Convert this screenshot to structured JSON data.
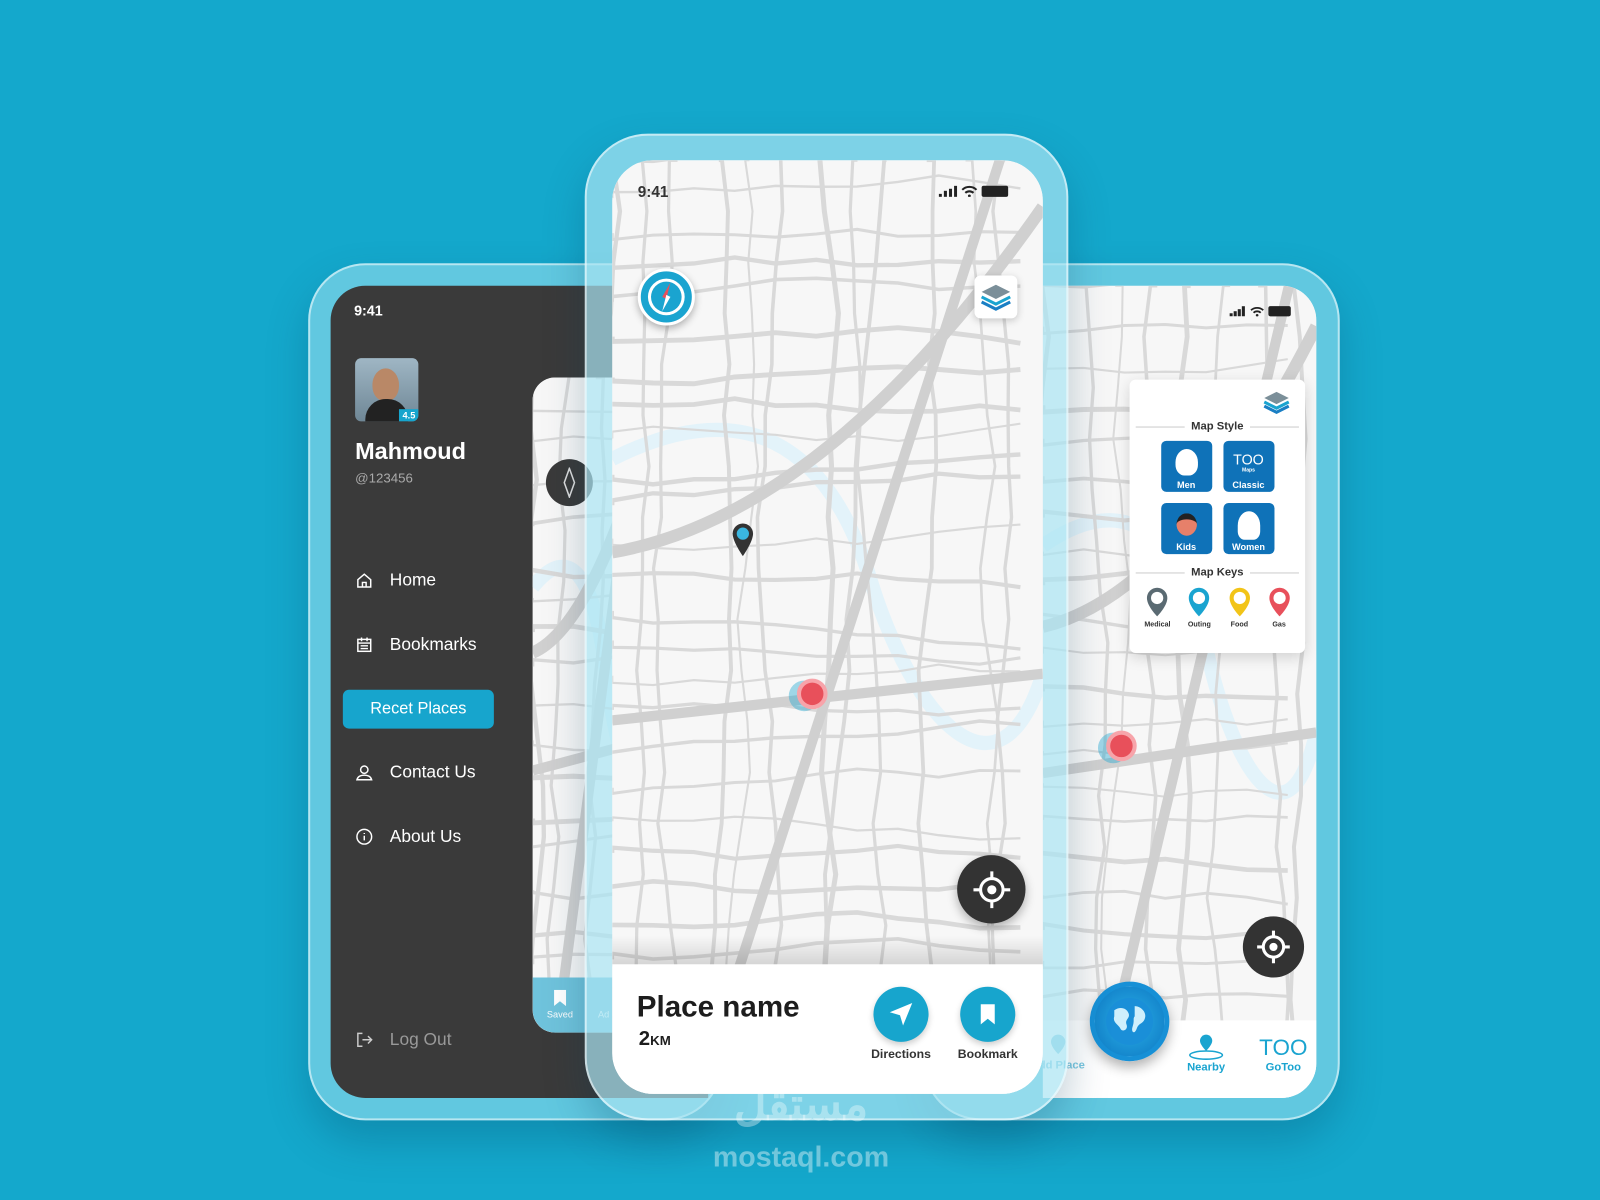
{
  "colors": {
    "background": "#14a8cc",
    "accent": "#17a5cd",
    "drawer": "#3a3a3a",
    "marker_red": "#e8505b"
  },
  "left_phone": {
    "status_time": "9:41",
    "profile": {
      "name": "Mahmoud",
      "handle": "@123456",
      "rating": "4.5"
    },
    "menu": [
      {
        "label": "Home",
        "icon": "home-icon"
      },
      {
        "label": "Bookmarks",
        "icon": "calendar-icon"
      },
      {
        "label": "Recet Places",
        "icon": "",
        "active": true
      },
      {
        "label": "Contact Us",
        "icon": "user-icon"
      },
      {
        "label": "About Us",
        "icon": "info-icon"
      }
    ],
    "logout": "Log Out",
    "peek_nav": {
      "saved": "Saved",
      "add": "Ad"
    }
  },
  "center_phone": {
    "status_time": "9:41",
    "place": {
      "name": "Place name",
      "distance": "2",
      "unit": "KM"
    },
    "actions": {
      "directions": "Directions",
      "bookmark": "Bookmark"
    }
  },
  "right_phone": {
    "map_style_title": "Map Style",
    "styles": [
      {
        "label": "Men"
      },
      {
        "label": "Classic",
        "logo": "TOO",
        "logo_sub": "Maps"
      },
      {
        "label": "Kids"
      },
      {
        "label": "Women"
      }
    ],
    "map_keys_title": "Map Keys",
    "keys": [
      {
        "label": "Medical",
        "color": "#5a6a72"
      },
      {
        "label": "Outing",
        "color": "#1aa4d0"
      },
      {
        "label": "Food",
        "color": "#f2c418"
      },
      {
        "label": "Gas",
        "color": "#e8505b"
      }
    ],
    "nav": {
      "add_place": "Add Place",
      "nearby": "Nearby",
      "gotoo": "GoToo",
      "gotoo_logo": "TOO"
    }
  },
  "watermark": {
    "arabic": "مستقل",
    "latin": "mostaql.com"
  }
}
